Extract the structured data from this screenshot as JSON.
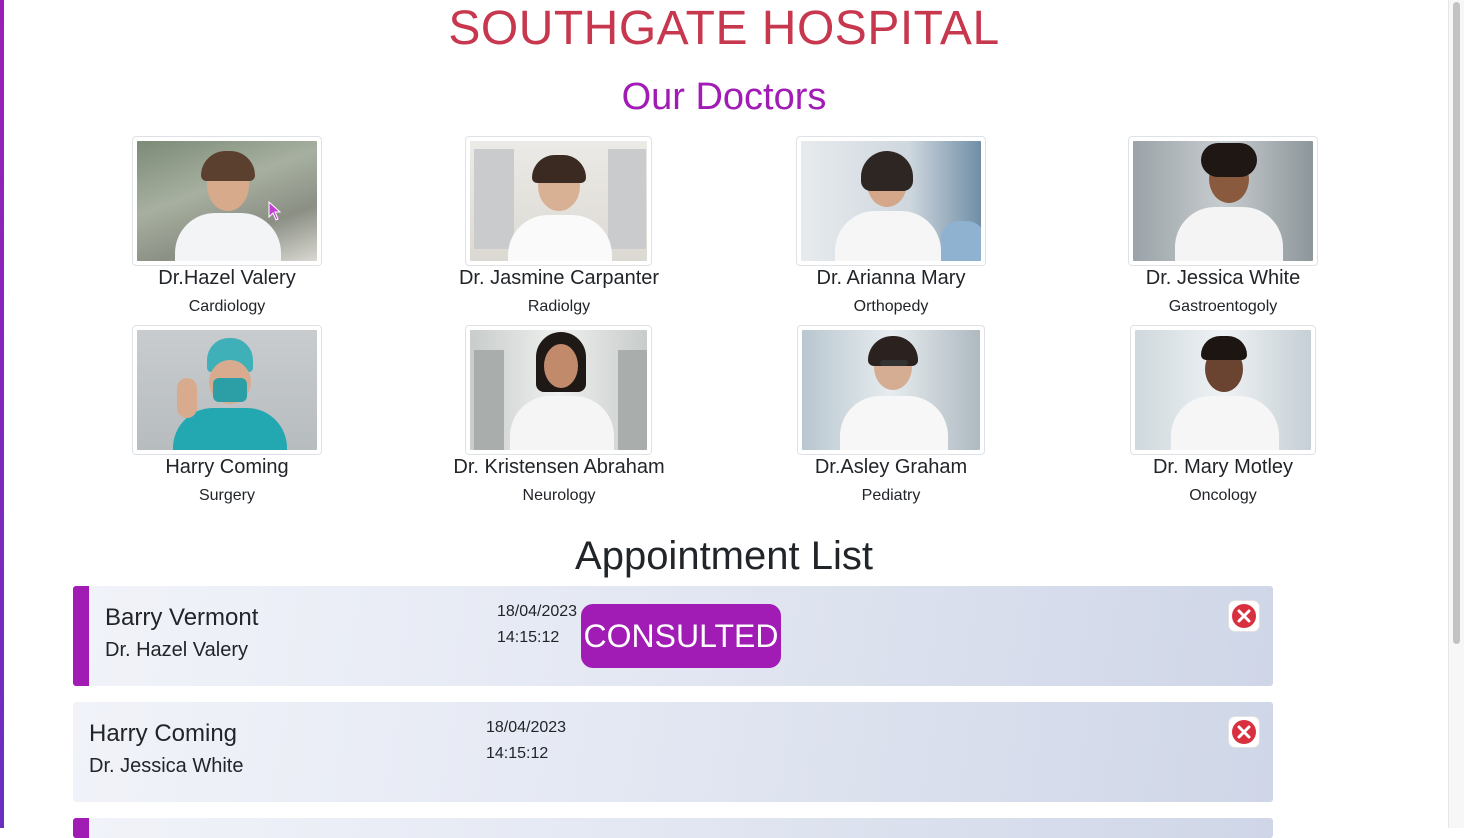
{
  "header": {
    "hospital_name": "SOUTHGATE HOSPITAL",
    "section_title": "Our Doctors"
  },
  "doctors": [
    {
      "name": "Dr.Hazel Valery",
      "specialty": "Cardiology"
    },
    {
      "name": "Dr. Jasmine Carpanter",
      "specialty": "Radiolgy"
    },
    {
      "name": "Dr. Arianna Mary",
      "specialty": "Orthopedy"
    },
    {
      "name": "Dr. Jessica White",
      "specialty": "Gastroentogoly"
    },
    {
      "name": "Harry Coming",
      "specialty": "Surgery"
    },
    {
      "name": "Dr. Kristensen Abraham",
      "specialty": "Neurology"
    },
    {
      "name": "Dr.Asley Graham",
      "specialty": "Pediatry"
    },
    {
      "name": "Dr. Mary Motley",
      "specialty": "Oncology"
    }
  ],
  "appointments": {
    "title": "Appointment List",
    "items": [
      {
        "patient": "Barry Vermont",
        "doctor": "Dr. Hazel Valery",
        "date": "18/04/2023",
        "time": "14:15:12",
        "status": "CONSULTED"
      },
      {
        "patient": "Harry Coming",
        "doctor": "Dr. Jessica White",
        "date": "18/04/2023",
        "time": "14:15:12",
        "status": ""
      }
    ]
  },
  "colors": {
    "title": "#c7374e",
    "accent": "#a11bb5",
    "delete": "#d9303f"
  },
  "icons": {
    "delete": "close-circle-icon",
    "cursor": "mouse-pointer-icon"
  }
}
